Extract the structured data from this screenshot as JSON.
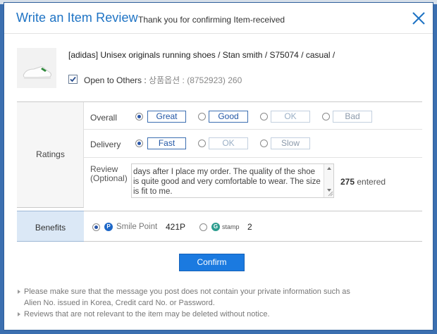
{
  "header": {
    "title": "Write an Item Review",
    "subtitle": "Thank you for confirming Item-received",
    "close_icon": "close-icon"
  },
  "product": {
    "name": "[adidas] Unisex originals running shoes / Stan smith / S75074 / casual /",
    "open_to_others_label": "Open to Others : ",
    "option_text": "상품옵션 : (8752923) 260",
    "open_checked": true
  },
  "ratings": {
    "section_label": "Ratings",
    "overall": {
      "label": "Overall",
      "options": [
        "Great",
        "Good",
        "OK",
        "Bad"
      ],
      "selected": "Great"
    },
    "delivery": {
      "label": "Delivery",
      "options": [
        "Fast",
        "OK",
        "Slow"
      ],
      "selected": "Fast"
    },
    "review": {
      "label": "Review",
      "label_optional": "(Optional)",
      "text": "days after I place my order. The quality of the shoe is quite good and very comfortable to wear. The size is fit to me.",
      "count": "275",
      "count_suffix": " entered"
    }
  },
  "benefits": {
    "section_label": "Benefits",
    "smile_point": {
      "icon_letter": "P",
      "label": "Smile Point",
      "value": "421P",
      "selected": true
    },
    "stamp": {
      "icon_letter": "G",
      "label": "stamp",
      "value": "2",
      "selected": false
    }
  },
  "confirm_label": "Confirm",
  "notes": [
    "Please make sure that the message you post does not contain your private information such as",
    "Alien No. issued in Korea, Credit card No. or Password.",
    "Reviews that are not relevant to the item may be deleted without notice."
  ],
  "colors": {
    "title": "#1e73c4",
    "accent_button": "#1b7ae0",
    "benefits_header_bg": "#dbe8f6"
  }
}
